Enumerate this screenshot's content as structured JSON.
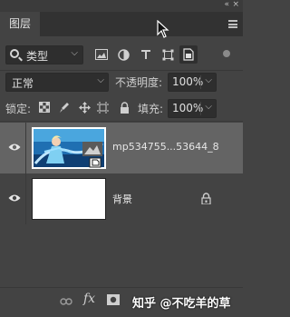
{
  "panel": {
    "collapse_glyph": "«",
    "close_glyph": "×",
    "tab_label": "图层"
  },
  "filter": {
    "kind_label": "类型",
    "icons": [
      "image-filter-icon",
      "adjustment-filter-icon",
      "type-filter-icon",
      "shape-filter-icon",
      "smart-object-filter-icon"
    ]
  },
  "blend": {
    "mode": "正常",
    "opacity_label": "不透明度:",
    "opacity_value": "100%"
  },
  "lock": {
    "label": "锁定:",
    "fill_label": "填充:",
    "fill_value": "100%"
  },
  "layers": [
    {
      "name": "mp534755...53644_8",
      "visible": true,
      "active": true
    },
    {
      "name": "背景",
      "visible": true,
      "active": false,
      "locked": true
    }
  ],
  "footer": {
    "fx_label": "fx",
    "watermark": "知乎 @不吃羊的草"
  },
  "colors": {
    "panel_bg": "#434343",
    "active_layer": "#646464",
    "field_bg": "#2e2e2e"
  }
}
